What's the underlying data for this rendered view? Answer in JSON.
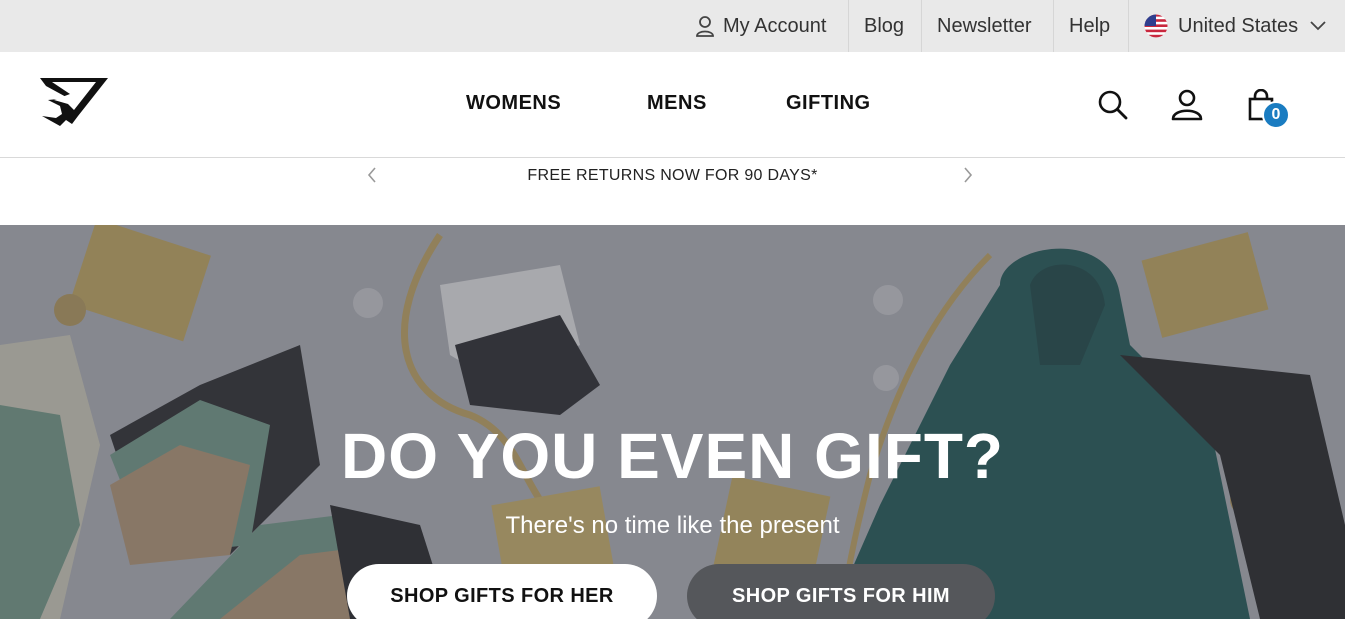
{
  "utility": {
    "account_label": "My Account",
    "blog_label": "Blog",
    "newsletter_label": "Newsletter",
    "help_label": "Help",
    "country_label": "United States"
  },
  "nav": {
    "womens": "WOMENS",
    "mens": "MENS",
    "gifting": "GIFTING"
  },
  "cart": {
    "count": "0"
  },
  "promo": {
    "text": "FREE RETURNS NOW FOR 90 DAYS*"
  },
  "hero": {
    "title": "DO YOU EVEN GIFT?",
    "subtitle": "There's no time like the present",
    "btn_her": "SHOP GIFTS FOR HER",
    "btn_him": "SHOP GIFTS FOR HIM"
  },
  "colors": {
    "badge": "#1a7cc1",
    "utility_bg": "#e9e9e9",
    "him_button": "#55575b"
  },
  "icons": [
    "user-icon",
    "us-flag-icon",
    "chevron-down-icon",
    "logo-icon",
    "search-icon",
    "account-icon",
    "bag-icon",
    "chevron-left-icon",
    "chevron-right-icon"
  ]
}
